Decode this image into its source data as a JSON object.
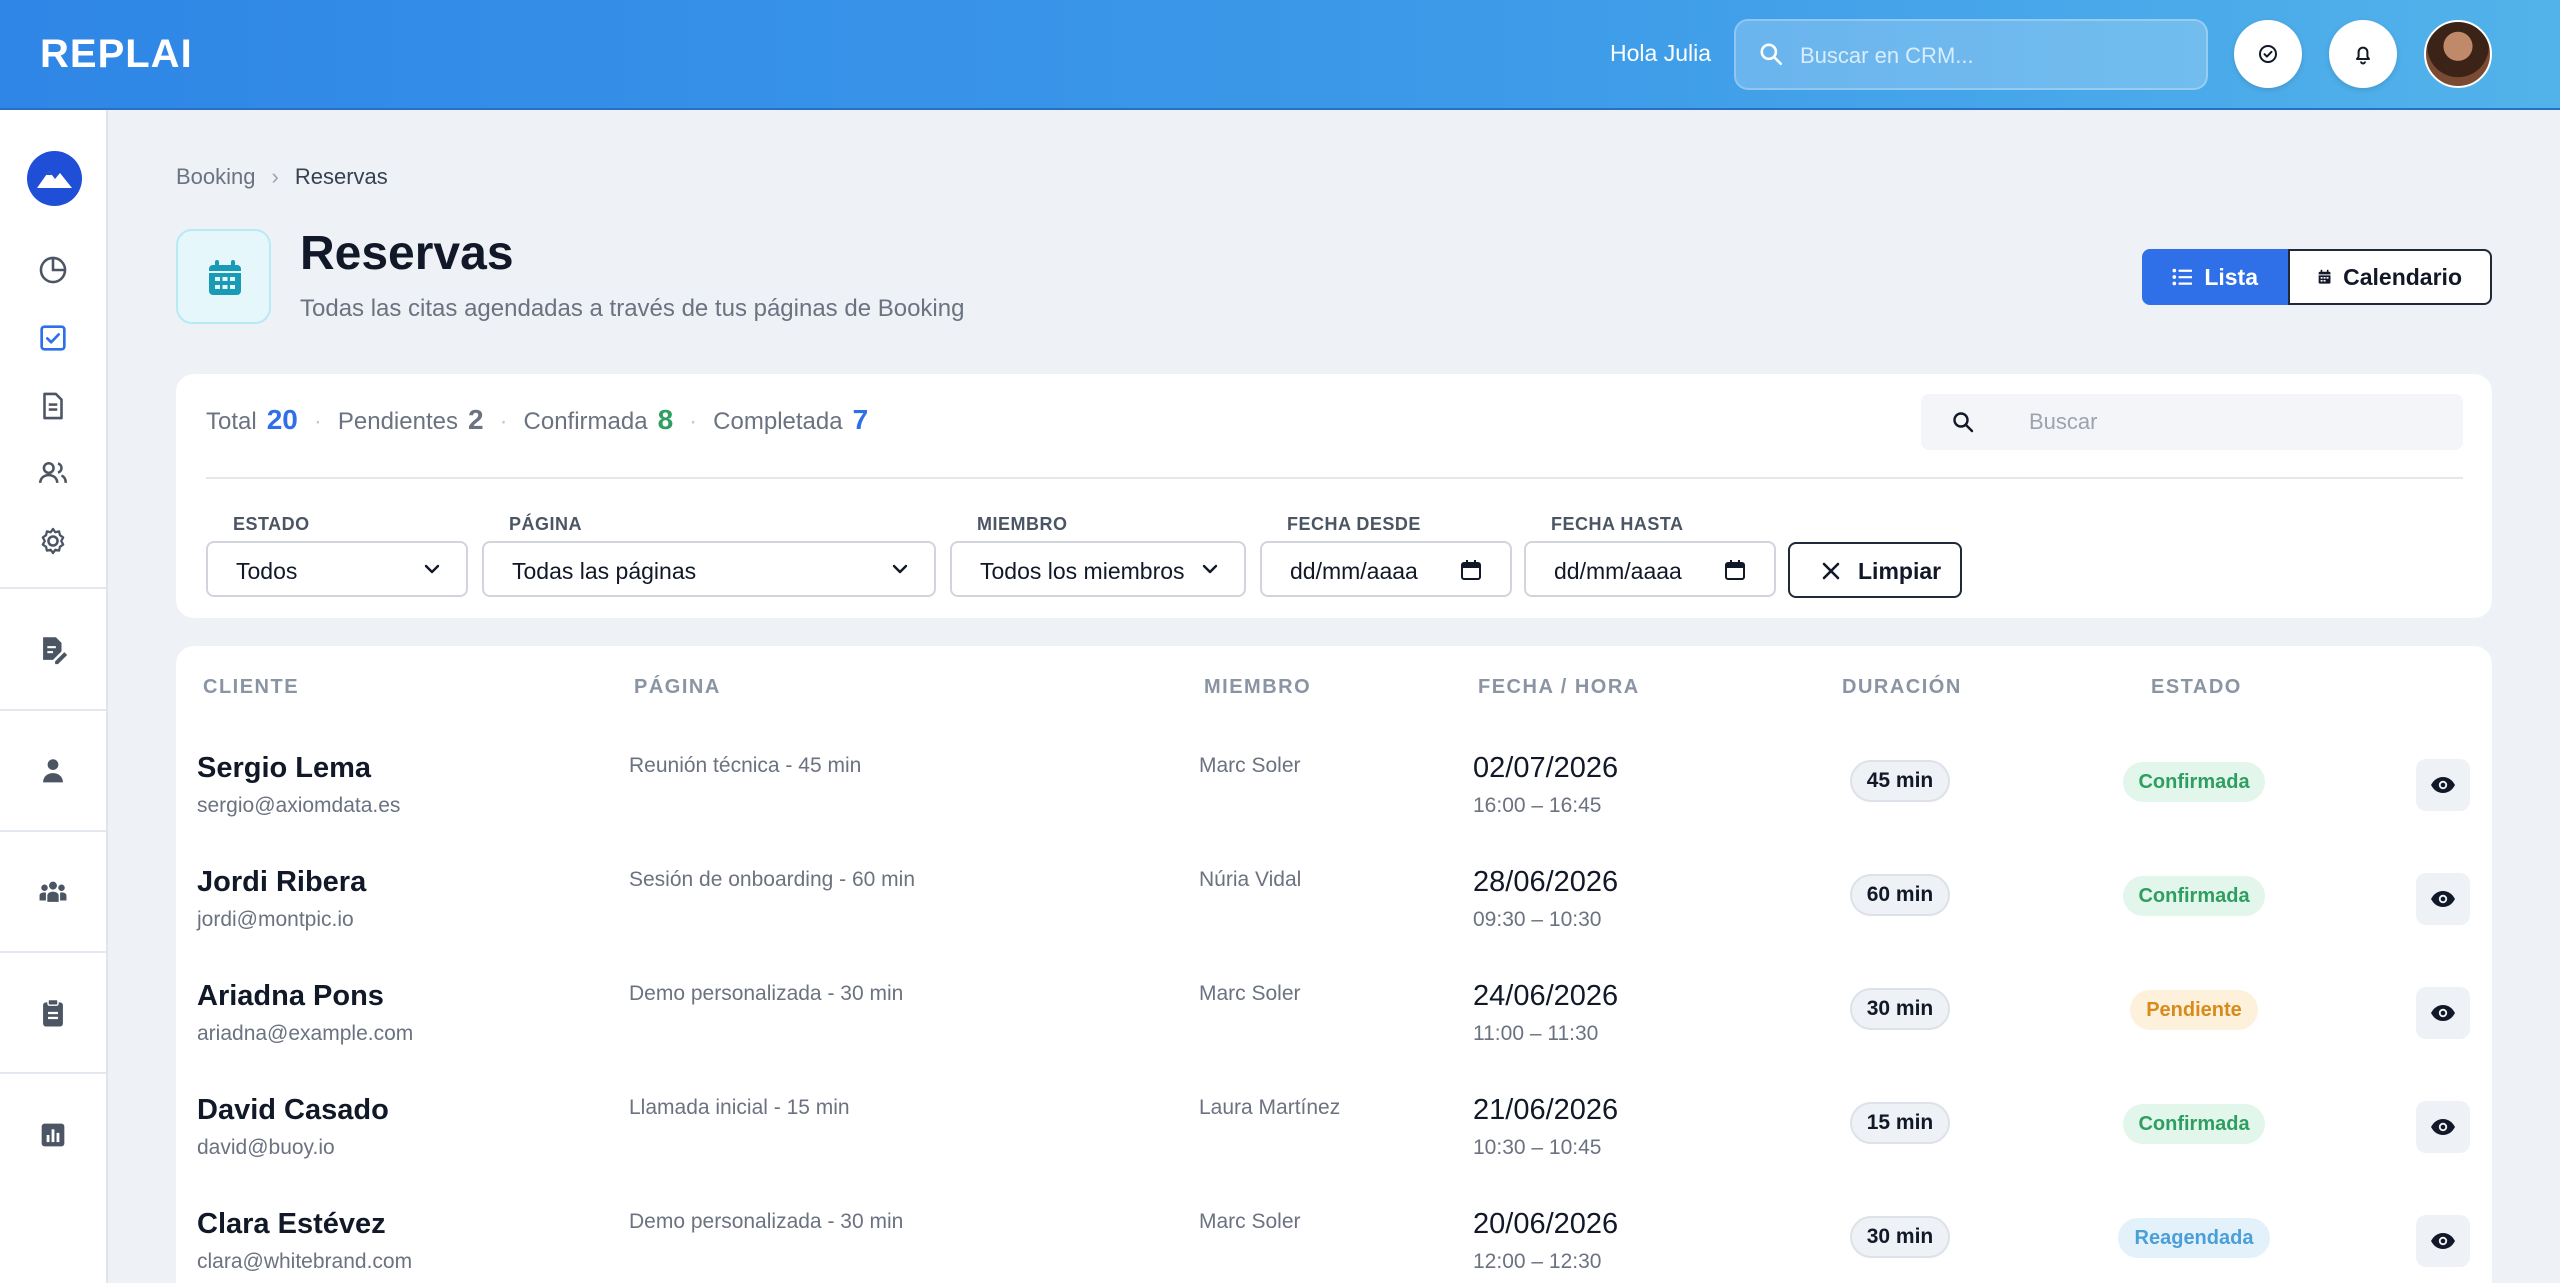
{
  "app": {
    "logo": "REPLAI"
  },
  "header": {
    "greeting": "Hola Julia",
    "search_placeholder": "Buscar en CRM..."
  },
  "breadcrumb": {
    "items": [
      "Booking",
      "Reservas"
    ]
  },
  "page": {
    "title": "Reservas",
    "subtitle": "Todas las citas agendadas a través de tus páginas de Booking"
  },
  "view_toggle": {
    "list_label": "Lista",
    "calendar_label": "Calendario"
  },
  "stats": {
    "total_label": "Total",
    "total": "20",
    "pending_label": "Pendientes",
    "pending": "2",
    "confirmed_label": "Confirmada",
    "confirmed": "8",
    "completed_label": "Completada",
    "completed": "7"
  },
  "search": {
    "placeholder": "Buscar"
  },
  "filters": {
    "estado": {
      "label": "ESTADO",
      "value": "Todos"
    },
    "pagina": {
      "label": "PÁGINA",
      "value": "Todas las páginas"
    },
    "miembro": {
      "label": "MIEMBRO",
      "value": "Todos los miembros"
    },
    "desde": {
      "label": "FECHA DESDE",
      "value": "dd/mm/aaaa"
    },
    "hasta": {
      "label": "FECHA HASTA",
      "value": "dd/mm/aaaa"
    },
    "clear_label": "Limpiar"
  },
  "table": {
    "columns": [
      "CLIENTE",
      "PÁGINA",
      "MIEMBRO",
      "FECHA / HORA",
      "DURACIÓN",
      "ESTADO"
    ],
    "rows": [
      {
        "name": "Sergio Lema",
        "email": "sergio@axiomdata.es",
        "page": "Reunión técnica - 45 min",
        "member": "Marc Soler",
        "date": "02/07/2026",
        "time": "16:00 – 16:45",
        "duration": "45 min",
        "status": "Confirmada",
        "status_key": "confirmada"
      },
      {
        "name": "Jordi Ribera",
        "email": "jordi@montpic.io",
        "page": "Sesión de onboarding - 60 min",
        "member": "Núria Vidal",
        "date": "28/06/2026",
        "time": "09:30 – 10:30",
        "duration": "60 min",
        "status": "Confirmada",
        "status_key": "confirmada"
      },
      {
        "name": "Ariadna Pons",
        "email": "ariadna@example.com",
        "page": "Demo personalizada - 30 min",
        "member": "Marc Soler",
        "date": "24/06/2026",
        "time": "11:00 – 11:30",
        "duration": "30 min",
        "status": "Pendiente",
        "status_key": "pendiente"
      },
      {
        "name": "David Casado",
        "email": "david@buoy.io",
        "page": "Llamada inicial - 15 min",
        "member": "Laura Martínez",
        "date": "21/06/2026",
        "time": "10:30 – 10:45",
        "duration": "15 min",
        "status": "Confirmada",
        "status_key": "confirmada"
      },
      {
        "name": "Clara Estévez",
        "email": "clara@whitebrand.com",
        "page": "Demo personalizada - 30 min",
        "member": "Marc Soler",
        "date": "20/06/2026",
        "time": "12:00 – 12:30",
        "duration": "30 min",
        "status": "Reagendada",
        "status_key": "reagendada"
      }
    ]
  },
  "colors": {
    "accent": "#2f6fe8",
    "topbar_start": "#2f86e6",
    "topbar_end": "#52b3ea",
    "confirmed": "#2f9e61",
    "pending": "#d88a1a",
    "rescheduled": "#4a9fd8",
    "total_num": "#2f6fe8",
    "pending_num": "#6b7280",
    "confirmed_num": "#2f9e61",
    "completed_num": "#2f6fe8"
  },
  "icons": {
    "topbar": [
      "search-icon",
      "check-circle-icon",
      "bell-icon",
      "avatar"
    ],
    "sidebar": [
      "mountain-logo-icon",
      "chart-pie-icon",
      "check-square-icon",
      "document-icon",
      "users-icon",
      "gear-icon",
      "document-edit-icon",
      "person-icon",
      "group-icon",
      "clipboard-icon",
      "bar-chart-icon"
    ]
  }
}
